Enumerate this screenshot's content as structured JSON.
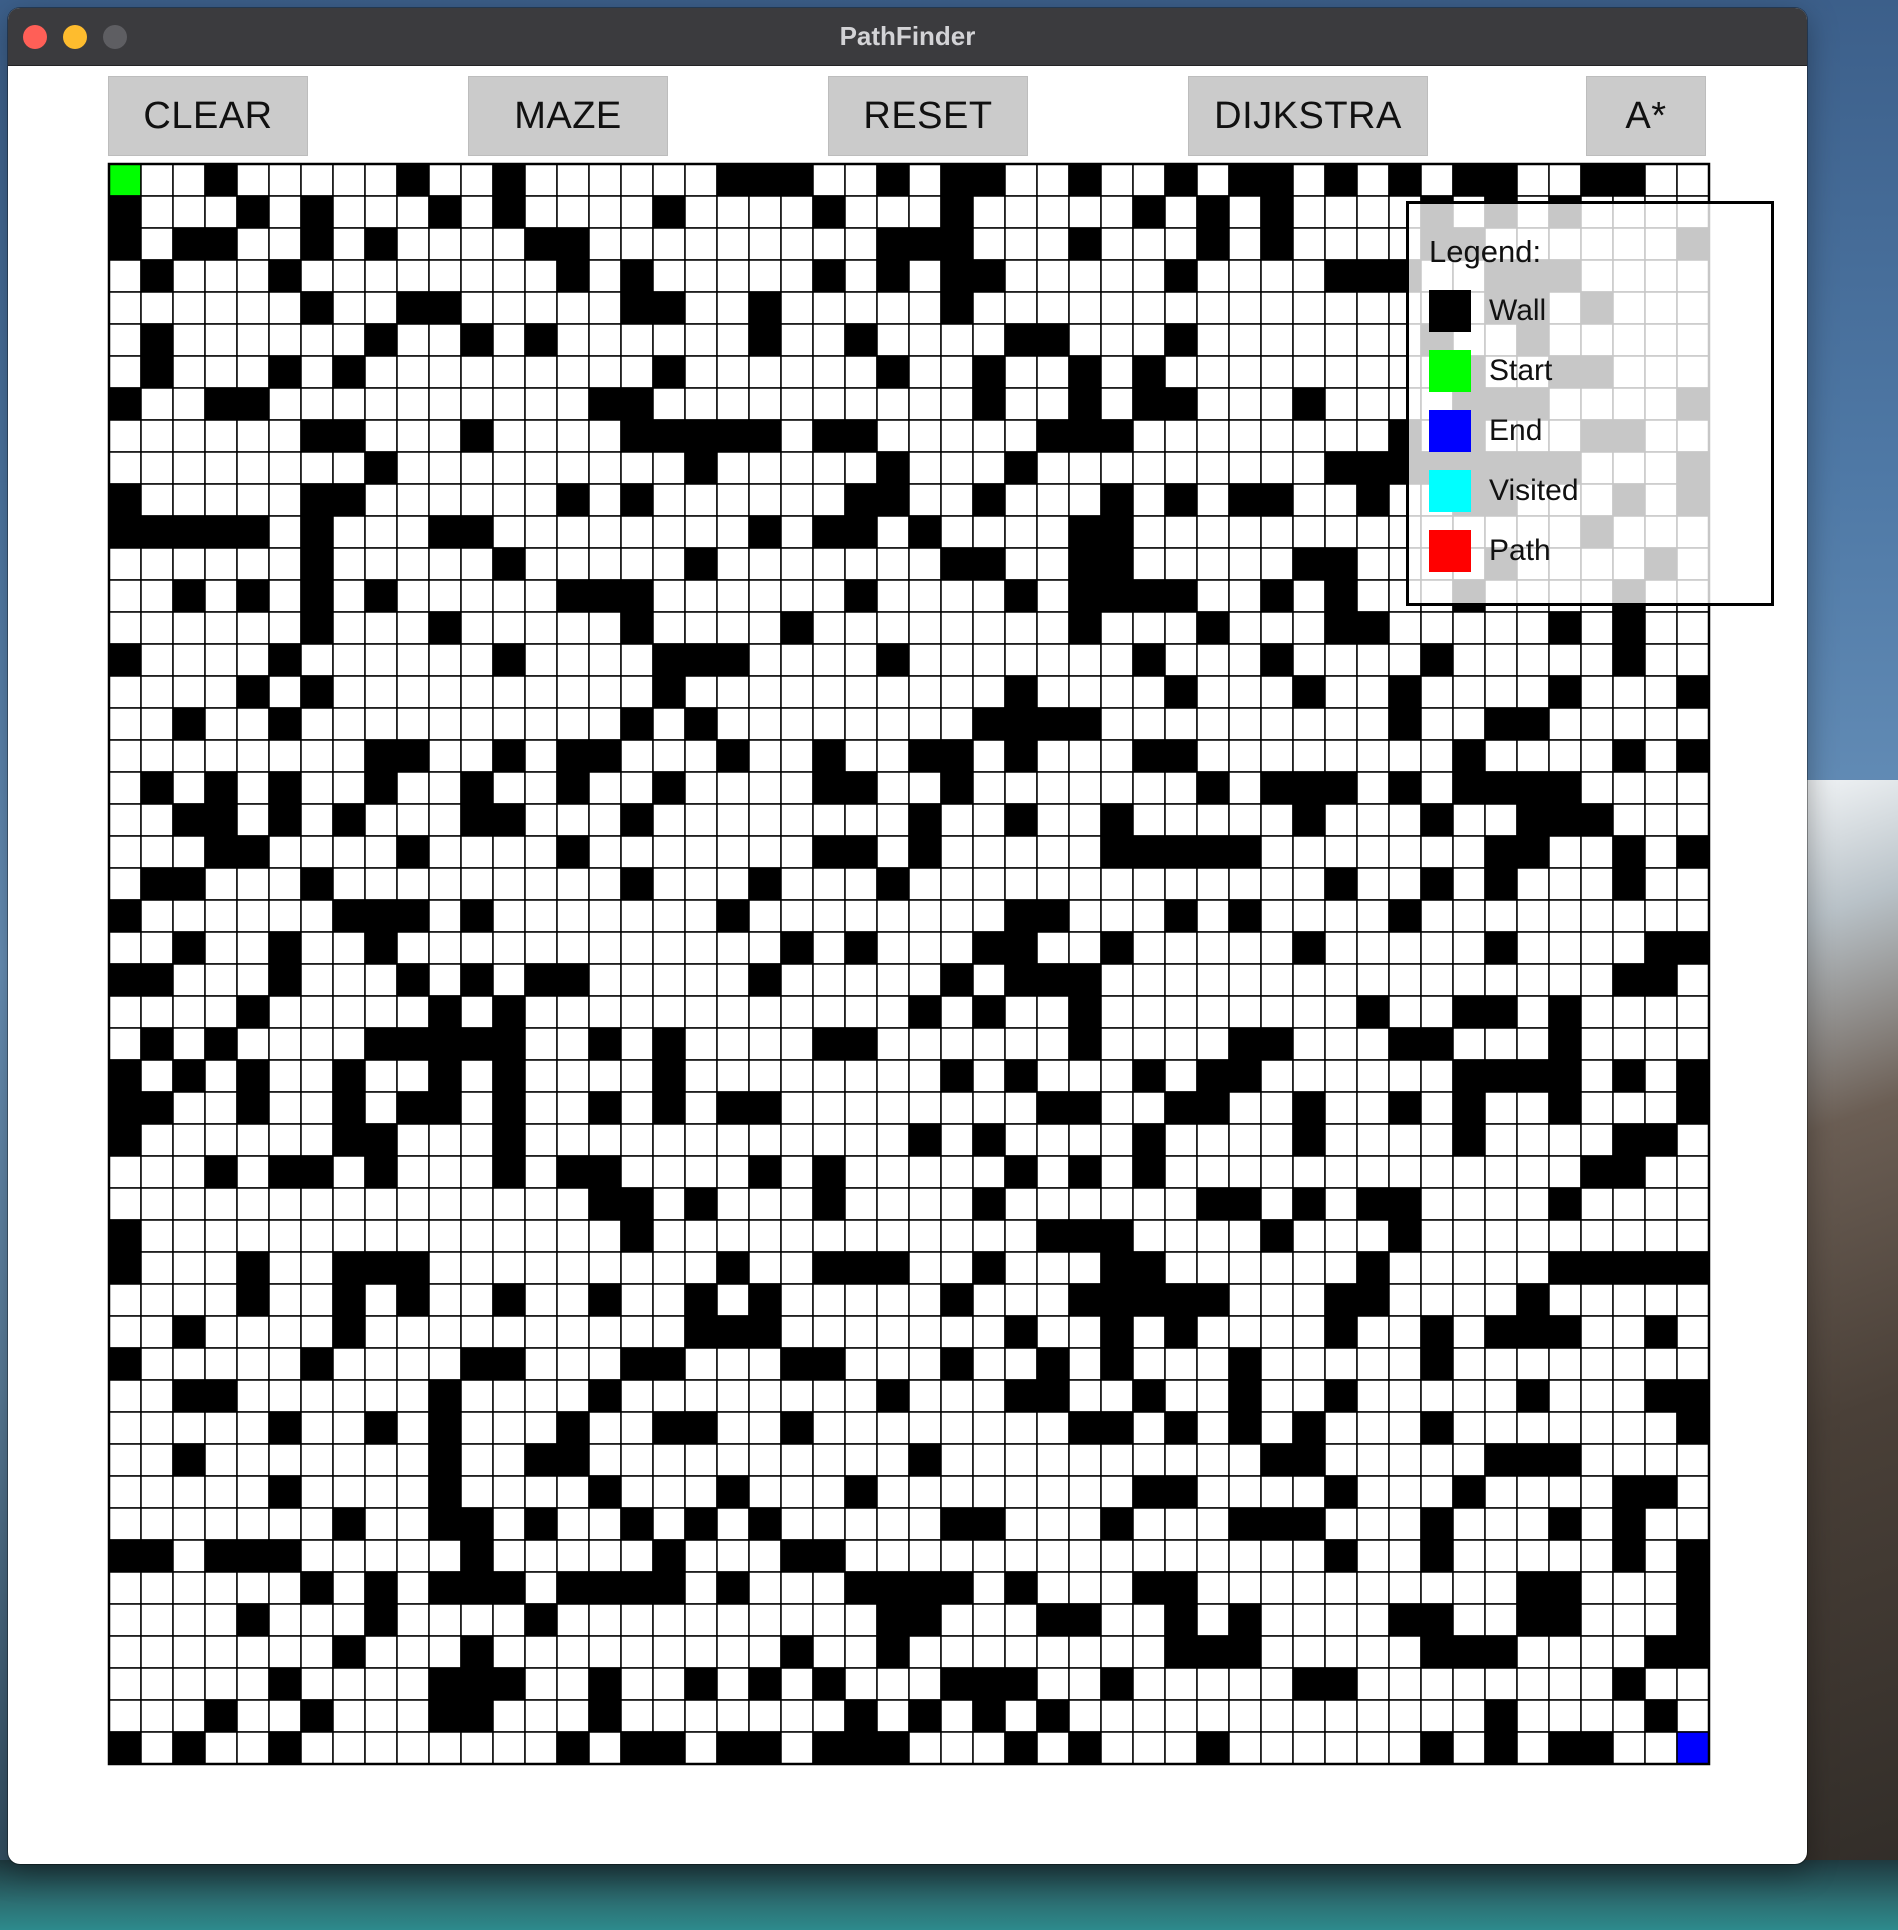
{
  "window": {
    "title": "PathFinder"
  },
  "toolbar": {
    "buttons": [
      {
        "label": "CLEAR"
      },
      {
        "label": "MAZE"
      },
      {
        "label": "RESET"
      },
      {
        "label": "DIJKSTRA"
      },
      {
        "label": "A*"
      }
    ]
  },
  "grid": {
    "rows": 50,
    "cols": 50,
    "start": [
      0,
      0
    ],
    "end": [
      49,
      49
    ],
    "wall_density": 0.27,
    "colors": {
      "wall": "#000000",
      "start": "#00ff00",
      "end": "#0000ff",
      "visited": "#00ffff",
      "path": "#ff0000",
      "empty": "#ffffff",
      "lines": "#000000"
    }
  },
  "legend": {
    "title": "Legend:",
    "items": [
      {
        "label": "Wall",
        "color": "#000000"
      },
      {
        "label": "Start",
        "color": "#00ff00"
      },
      {
        "label": "End",
        "color": "#0000ff"
      },
      {
        "label": "Visited",
        "color": "#00ffff"
      },
      {
        "label": "Path",
        "color": "#ff0000"
      }
    ]
  }
}
